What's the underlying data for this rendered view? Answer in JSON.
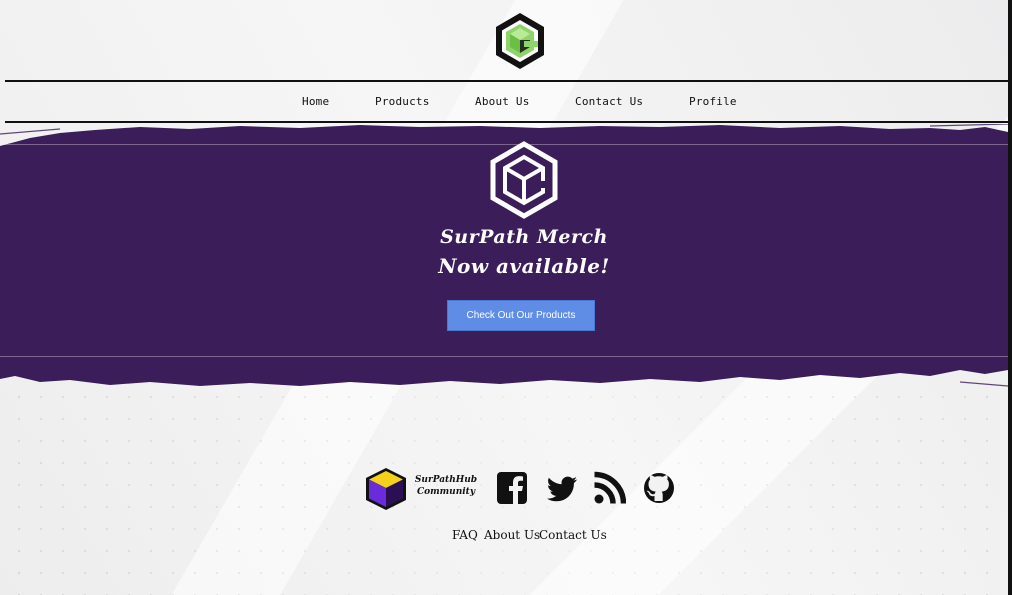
{
  "header": {
    "nav": [
      {
        "label": "Home"
      },
      {
        "label": "Products"
      },
      {
        "label": "About Us"
      },
      {
        "label": "Contact Us"
      },
      {
        "label": "Profile"
      }
    ]
  },
  "hero": {
    "title_line1": "SurPath Merch",
    "title_line2": "Now available!",
    "cta_label": "Check Out Our Products"
  },
  "footer": {
    "community_logo_text_line1": "SurPathHub",
    "community_logo_text_line2": "Community",
    "social_icons": [
      "facebook-icon",
      "twitter-icon",
      "rss-icon",
      "github-icon"
    ],
    "links": [
      {
        "label": "FAQ"
      },
      {
        "label": "About Us"
      },
      {
        "label": "Contact Us"
      }
    ]
  },
  "colors": {
    "hero_purple": "#3b1d5a",
    "cta_blue": "#5f8de6",
    "logo_green": "#8fd46a"
  }
}
